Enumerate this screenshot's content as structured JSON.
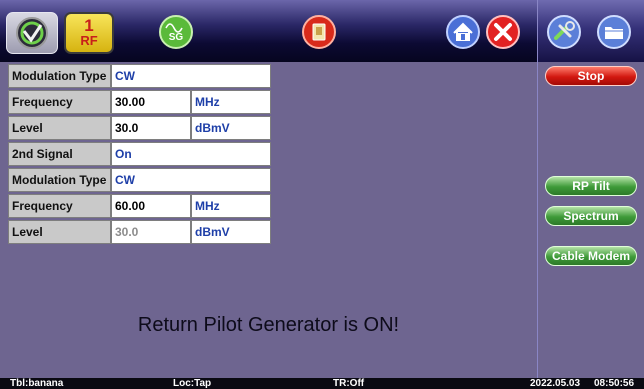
{
  "toolbar": {
    "rf_number": "1",
    "rf_label": "RF",
    "sg_label": "SG"
  },
  "table": {
    "rows": [
      {
        "label": "Modulation Type",
        "value": "CW",
        "unit": ""
      },
      {
        "label": "Frequency",
        "value": "30.00",
        "unit": "MHz"
      },
      {
        "label": "Level",
        "value": "30.0",
        "unit": "dBmV"
      },
      {
        "label": "2nd Signal",
        "value": "On",
        "unit": ""
      },
      {
        "label": "Modulation Type",
        "value": "CW",
        "unit": ""
      },
      {
        "label": "Frequency",
        "value": "60.00",
        "unit": "MHz"
      },
      {
        "label": "Level",
        "value": "30.0",
        "unit": "dBmV"
      }
    ]
  },
  "message": "Return Pilot Generator is ON!",
  "side_buttons": {
    "stop": "Stop",
    "rp_tilt": "RP Tilt",
    "spectrum": "Spectrum",
    "cable_modem": "Cable Modem"
  },
  "status": {
    "tbl": "Tbl:banana",
    "loc": "Loc:Tap",
    "tr": "TR:Off",
    "date": "2022.05.03",
    "time": "08:50:56"
  },
  "colors": {
    "background": "#6e6590",
    "value_text": "#1e3fa8",
    "stop_button": "#d21810",
    "green_button": "#3e9a38"
  }
}
